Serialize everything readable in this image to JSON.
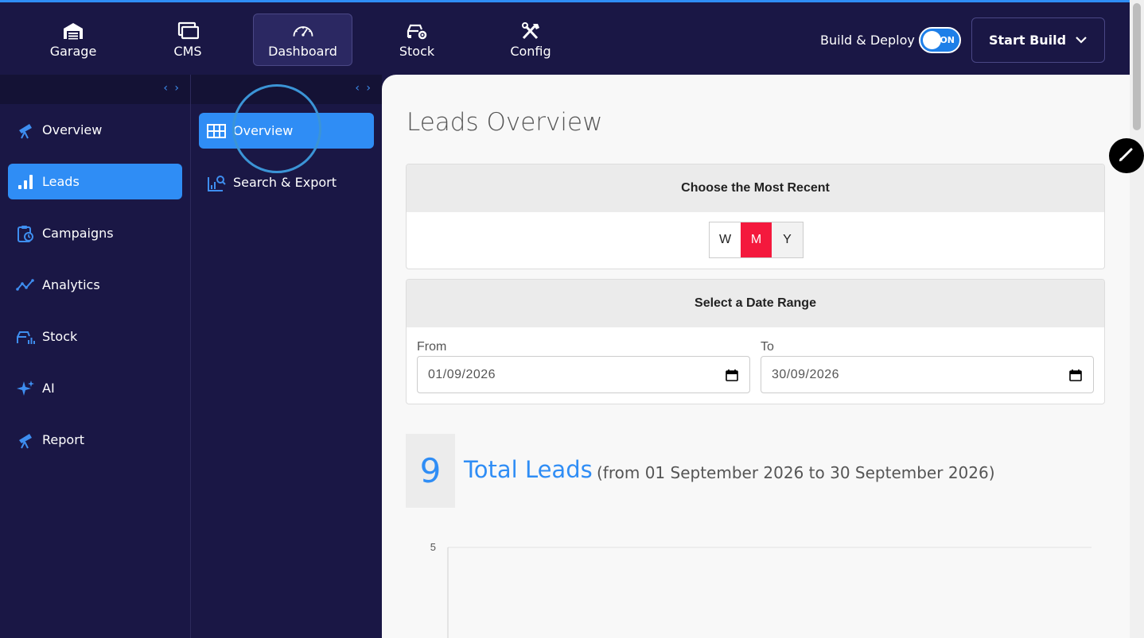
{
  "topnav": {
    "items": [
      {
        "label": "Garage",
        "icon": "garage-icon"
      },
      {
        "label": "CMS",
        "icon": "cms-icon"
      },
      {
        "label": "Dashboard",
        "icon": "speedometer-icon"
      },
      {
        "label": "Stock",
        "icon": "car-gear-icon"
      },
      {
        "label": "Config",
        "icon": "tools-icon"
      }
    ],
    "active": "Dashboard",
    "build_deploy_label": "Build & Deploy",
    "toggle_label": "ON",
    "start_build_label": "Start Build"
  },
  "sidebar": {
    "items": [
      {
        "label": "Overview",
        "icon": "telescope-icon"
      },
      {
        "label": "Leads",
        "icon": "bar-chart-icon"
      },
      {
        "label": "Campaigns",
        "icon": "clipboard-clock-icon"
      },
      {
        "label": "Analytics",
        "icon": "line-chart-icon"
      },
      {
        "label": "Stock",
        "icon": "car-chart-icon"
      },
      {
        "label": "AI",
        "icon": "sparkle-icon"
      },
      {
        "label": "Report",
        "icon": "telescope-icon"
      }
    ],
    "active": "Leads"
  },
  "subnav": {
    "items": [
      {
        "label": "Overview",
        "icon": "grid-layout-icon"
      },
      {
        "label": "Search & Export",
        "icon": "search-chart-icon"
      }
    ],
    "active": "Overview"
  },
  "main": {
    "title": "Leads Overview",
    "recent": {
      "heading": "Choose the Most Recent",
      "options": [
        "W",
        "M",
        "Y"
      ],
      "selected": "M"
    },
    "range": {
      "heading": "Select a Date Range",
      "from_label": "From",
      "from_value": "01/09/2026",
      "to_label": "To",
      "to_value": "30/09/2026"
    },
    "total": {
      "count": "9",
      "label": "Total Leads",
      "range_text": "(from 01 September 2026 to 30 September 2026)"
    }
  },
  "chart_data": {
    "type": "line",
    "y_ticks": [
      "5"
    ],
    "ylim": [
      0,
      5
    ]
  },
  "colors": {
    "nav_bg": "#1a1745",
    "accent": "#2f8df5",
    "selected_red": "#f4193d"
  }
}
